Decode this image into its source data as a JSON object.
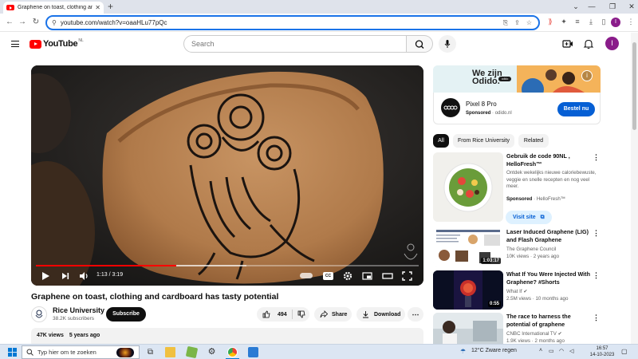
{
  "browser": {
    "tab_title": "Graphene on toast, clothing and cardboard has tasty potential - YouTube",
    "new_tab_label": "+",
    "url": "youtube.com/watch?v=oaaHLu77pQc"
  },
  "masthead": {
    "logo_text": "YouTube",
    "region": "NL",
    "search_placeholder": "Search",
    "avatar_letter": "I"
  },
  "player": {
    "time": "1:13 / 3:19",
    "played_fraction": 0.367,
    "buffered_fraction": 0.55,
    "cc_label": "CC"
  },
  "video": {
    "title": "Graphene on toast, clothing and cardboard has tasty potential",
    "channel": "Rice University",
    "subscribers": "38.2K subscribers",
    "subscribe_label": "Subscribe",
    "likes": "494",
    "share_label": "Share",
    "download_label": "Download",
    "views": "47K views",
    "age": "5 years ago"
  },
  "ad": {
    "slogan_line1": "We zijn",
    "slogan_line2": "Odido.",
    "logo_text": "odido",
    "title": "Pixel 8 Pro",
    "sponsored": "Sponsored",
    "domain": "odido.nl",
    "cta": "Bestel nu"
  },
  "chips": [
    "All",
    "From Rice University",
    "Related"
  ],
  "recommendations": [
    {
      "title": "Gebruik de code 90NL , HelloFresh™",
      "desc": "Ontdek wekelijks nieuwe caloriebewuste, veggie en snelle recepten en nog veel meer.",
      "sponsored": "Sponsored",
      "channel": "HelloFresh™",
      "cta": "Visit site"
    },
    {
      "title": "Laser Induced Graphene (LIG) and Flash Graphene",
      "channel": "The Graphene Council",
      "views": "10K views",
      "age": "2 years ago",
      "duration": "1:03:17"
    },
    {
      "title": "What If You Were Injected With Graphene? #Shorts",
      "channel": "What If",
      "views": "2.5M views",
      "age": "10 months ago",
      "duration": "0:55"
    },
    {
      "title": "The race to harness the potential of graphene",
      "channel": "CNBC International TV",
      "views": "1.9K views",
      "age": "2 months ago"
    }
  ],
  "taskbar": {
    "search_placeholder": "Typ hier om te zoeken",
    "weather": "12°C  Zware regen",
    "time": "16:57",
    "date": "14-10-2023"
  },
  "colors": {
    "youtube_red": "#ff0000",
    "accent_blue": "#065fd4",
    "omnibox_focus": "#1a73e8"
  }
}
